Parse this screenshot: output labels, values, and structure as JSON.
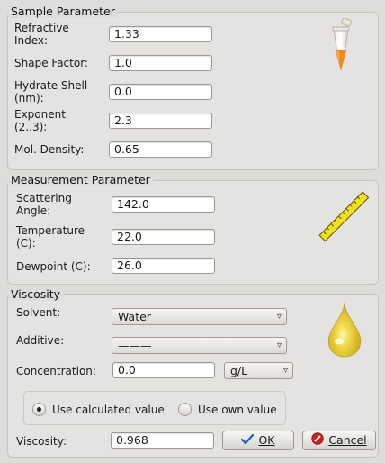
{
  "sample": {
    "title": "Sample Parameter",
    "rows": [
      {
        "label": "Refractive\nIndex:",
        "value": "1.33"
      },
      {
        "label": "Shape Factor:",
        "value": "1.0"
      },
      {
        "label": "Hydrate Shell\n(nm):",
        "value": "0.0"
      },
      {
        "label": "Exponent\n(2..3):",
        "value": "2.3"
      },
      {
        "label": "Mol. Density:",
        "value": "0.65"
      }
    ],
    "icon": "test-tube-icon"
  },
  "measurement": {
    "title": "Measurement Parameter",
    "rows": [
      {
        "label": "Scattering\nAngle:",
        "value": "142.0"
      },
      {
        "label": "Temperature\n(C):",
        "value": "22.0"
      },
      {
        "label": "Dewpoint (C):",
        "value": "26.0"
      }
    ],
    "icon": "ruler-icon"
  },
  "viscosity": {
    "title": "Viscosity",
    "solvent_label": "Solvent:",
    "solvent_value": "Water",
    "additive_label": "Additive:",
    "additive_value": "———",
    "concentration_label": "Concentration:",
    "concentration_value": "0.0",
    "concentration_unit": "g/L",
    "radio_calculated": "Use calculated value",
    "radio_own": "Use own value",
    "selected": "calculated",
    "viscosity_label": "Viscosity:",
    "viscosity_value": "0.968",
    "icon": "drop-icon"
  },
  "buttons": {
    "ok": "OK",
    "cancel": "Cancel"
  },
  "colors": {
    "accent": "#e7c630"
  }
}
